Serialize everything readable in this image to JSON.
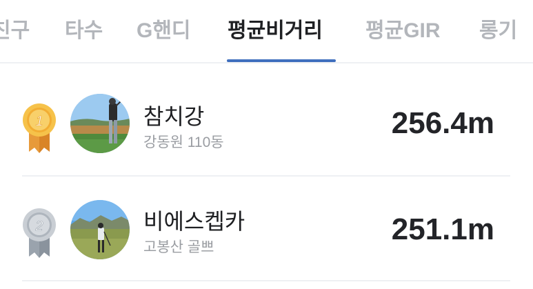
{
  "tabs": [
    {
      "label": "친구"
    },
    {
      "label": "타수"
    },
    {
      "label": "G핸디"
    },
    {
      "label": "평균비거리"
    },
    {
      "label": "평균GIR"
    },
    {
      "label": "롱기"
    }
  ],
  "active_tab": "평균비거리",
  "ranking": [
    {
      "rank": "1",
      "name": "참치강",
      "location": "강동원 110동",
      "distance": "256.4m",
      "medal": "gold-medal-icon"
    },
    {
      "rank": "2",
      "name": "비에스켑카",
      "location": "고봉산 골쁘",
      "distance": "251.1m",
      "medal": "silver-medal-icon"
    }
  ],
  "colors": {
    "accent": "#3f6fbe",
    "gold": "#f2b33a",
    "silver": "#a9b0b8"
  }
}
